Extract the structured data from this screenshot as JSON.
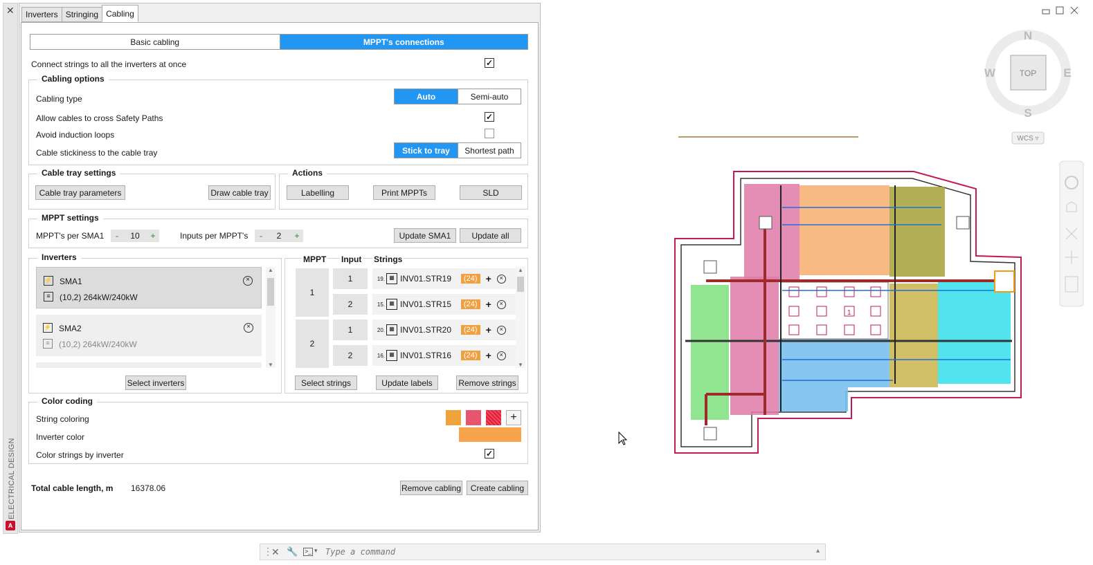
{
  "sidebar": {
    "close": "✕",
    "title": "ELECTRICAL DESIGN",
    "logo": "A"
  },
  "tabs": [
    {
      "label": "Inverters"
    },
    {
      "label": "Stringing"
    },
    {
      "label": "Cabling"
    }
  ],
  "mode_toggle": {
    "basic": "Basic cabling",
    "mppt": "MPPT's connections"
  },
  "connect_all": {
    "label": "Connect strings to all the inverters at once",
    "checked": "✓"
  },
  "cabling_options": {
    "title": "Cabling options",
    "cabling_type": {
      "label": "Cabling type",
      "auto": "Auto",
      "semi": "Semi-auto"
    },
    "allow_cross": {
      "label": "Allow cables to cross Safety Paths",
      "checked": "✓"
    },
    "avoid_loops": {
      "label": "Avoid induction loops",
      "checked": ""
    },
    "stickiness": {
      "label": "Cable stickiness to the cable tray",
      "stick": "Stick to tray",
      "shortest": "Shortest path"
    }
  },
  "cable_tray": {
    "title": "Cable tray settings",
    "params": "Cable tray parameters",
    "draw": "Draw cable tray"
  },
  "actions": {
    "title": "Actions",
    "labelling": "Labelling",
    "print": "Print MPPTs",
    "sld": "SLD"
  },
  "mppt_settings": {
    "title": "MPPT settings",
    "per_sma_label": "MPPT's per SMA1",
    "per_sma_value": "10",
    "inputs_label": "Inputs per MPPT's",
    "inputs_value": "2",
    "minus": "-",
    "plus": "+",
    "update_sma": "Update SMA1",
    "update_all": "Update all"
  },
  "inverters": {
    "title": "Inverters",
    "items": [
      {
        "name": "SMA1",
        "spec": "(10,2)  264kW/240kW"
      },
      {
        "name": "SMA2",
        "spec": "(10,2)  264kW/240kW"
      }
    ],
    "select": "Select inverters"
  },
  "strings_panel": {
    "headers": {
      "mppt": "MPPT",
      "input": "Input",
      "strings": "Strings"
    },
    "mppts": [
      "1",
      "2"
    ],
    "rows": [
      {
        "input": "1",
        "num": "19.",
        "name": "INV01.STR19",
        "count": "(24)"
      },
      {
        "input": "2",
        "num": "15.",
        "name": "INV01.STR15",
        "count": "(24)"
      },
      {
        "input": "1",
        "num": "20.",
        "name": "INV01.STR20",
        "count": "(24)"
      },
      {
        "input": "2",
        "num": "16.",
        "name": "INV01.STR16",
        "count": "(24)"
      }
    ],
    "select": "Select strings",
    "update_labels": "Update labels",
    "remove": "Remove strings"
  },
  "color_coding": {
    "title": "Color coding",
    "string_coloring": "String coloring",
    "inverter_color": "Inverter color",
    "by_inverter": "Color strings by inverter",
    "by_inverter_checked": "✓",
    "swatches": [
      "#eea43a",
      "#e8556e",
      "#e01e37"
    ],
    "inverter_swatch": "#f8a44c",
    "add": "+"
  },
  "total": {
    "label": "Total cable length, m",
    "value": "16378.06"
  },
  "footer": {
    "remove": "Remove cabling",
    "create": "Create cabling"
  },
  "viewcube": {
    "n": "N",
    "s": "S",
    "e": "E",
    "w": "W",
    "top": "TOP",
    "wcs": "WCS ▿"
  },
  "cad_label": "1",
  "command": {
    "placeholder": "Type a command"
  }
}
